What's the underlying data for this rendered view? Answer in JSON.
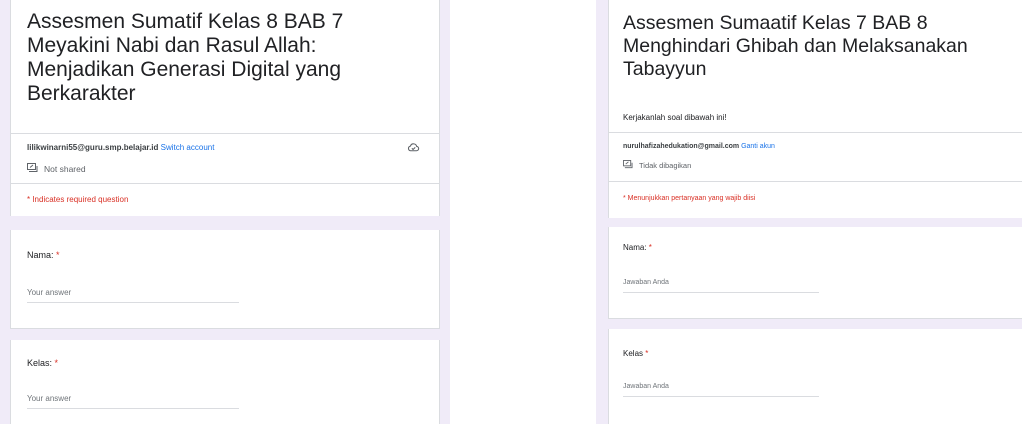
{
  "left_form": {
    "title_lines": [
      "Assesmen Sumatif Kelas 8 BAB 7",
      "Meyakini Nabi dan Rasul Allah:",
      "Menjadikan Generasi Digital yang",
      "Berkarakter"
    ],
    "account_email": "lilikwinarni55@guru.smp.belajar.id",
    "switch_account_label": "Switch account",
    "shared_status": "Not shared",
    "required_note": "* Indicates required question",
    "questions": [
      {
        "label": "Nama:",
        "required_mark": "*",
        "placeholder": "Your answer"
      },
      {
        "label": "Kelas:",
        "required_mark": "*",
        "placeholder": "Your answer"
      }
    ],
    "icons": [
      "not-shared-icon",
      "cloud-save-icon"
    ]
  },
  "right_form": {
    "title_lines": [
      "Assesmen Sumaatif Kelas 7 BAB 8",
      "Menghindari Ghibah dan Melaksanakan",
      "Tabayyun"
    ],
    "description": "Kerjakanlah soal dibawah ini!",
    "account_email": "nurulhafizahedukation@gmail.com",
    "switch_account_label": "Ganti akun",
    "shared_status": "Tidak dibagikan",
    "required_note": "* Menunjukkan pertanyaan yang wajib diisi",
    "questions": [
      {
        "label": "Nama:",
        "required_mark": "*",
        "placeholder": "Jawaban Anda"
      },
      {
        "label": "Kelas",
        "required_mark": "*",
        "placeholder": "Jawaban Anda"
      }
    ],
    "icons": [
      "not-shared-icon"
    ]
  },
  "colors": {
    "background": "#f0ebf8",
    "card": "#ffffff",
    "required": "#d93025",
    "link": "#1a73e8",
    "divider": "#dadce0"
  }
}
